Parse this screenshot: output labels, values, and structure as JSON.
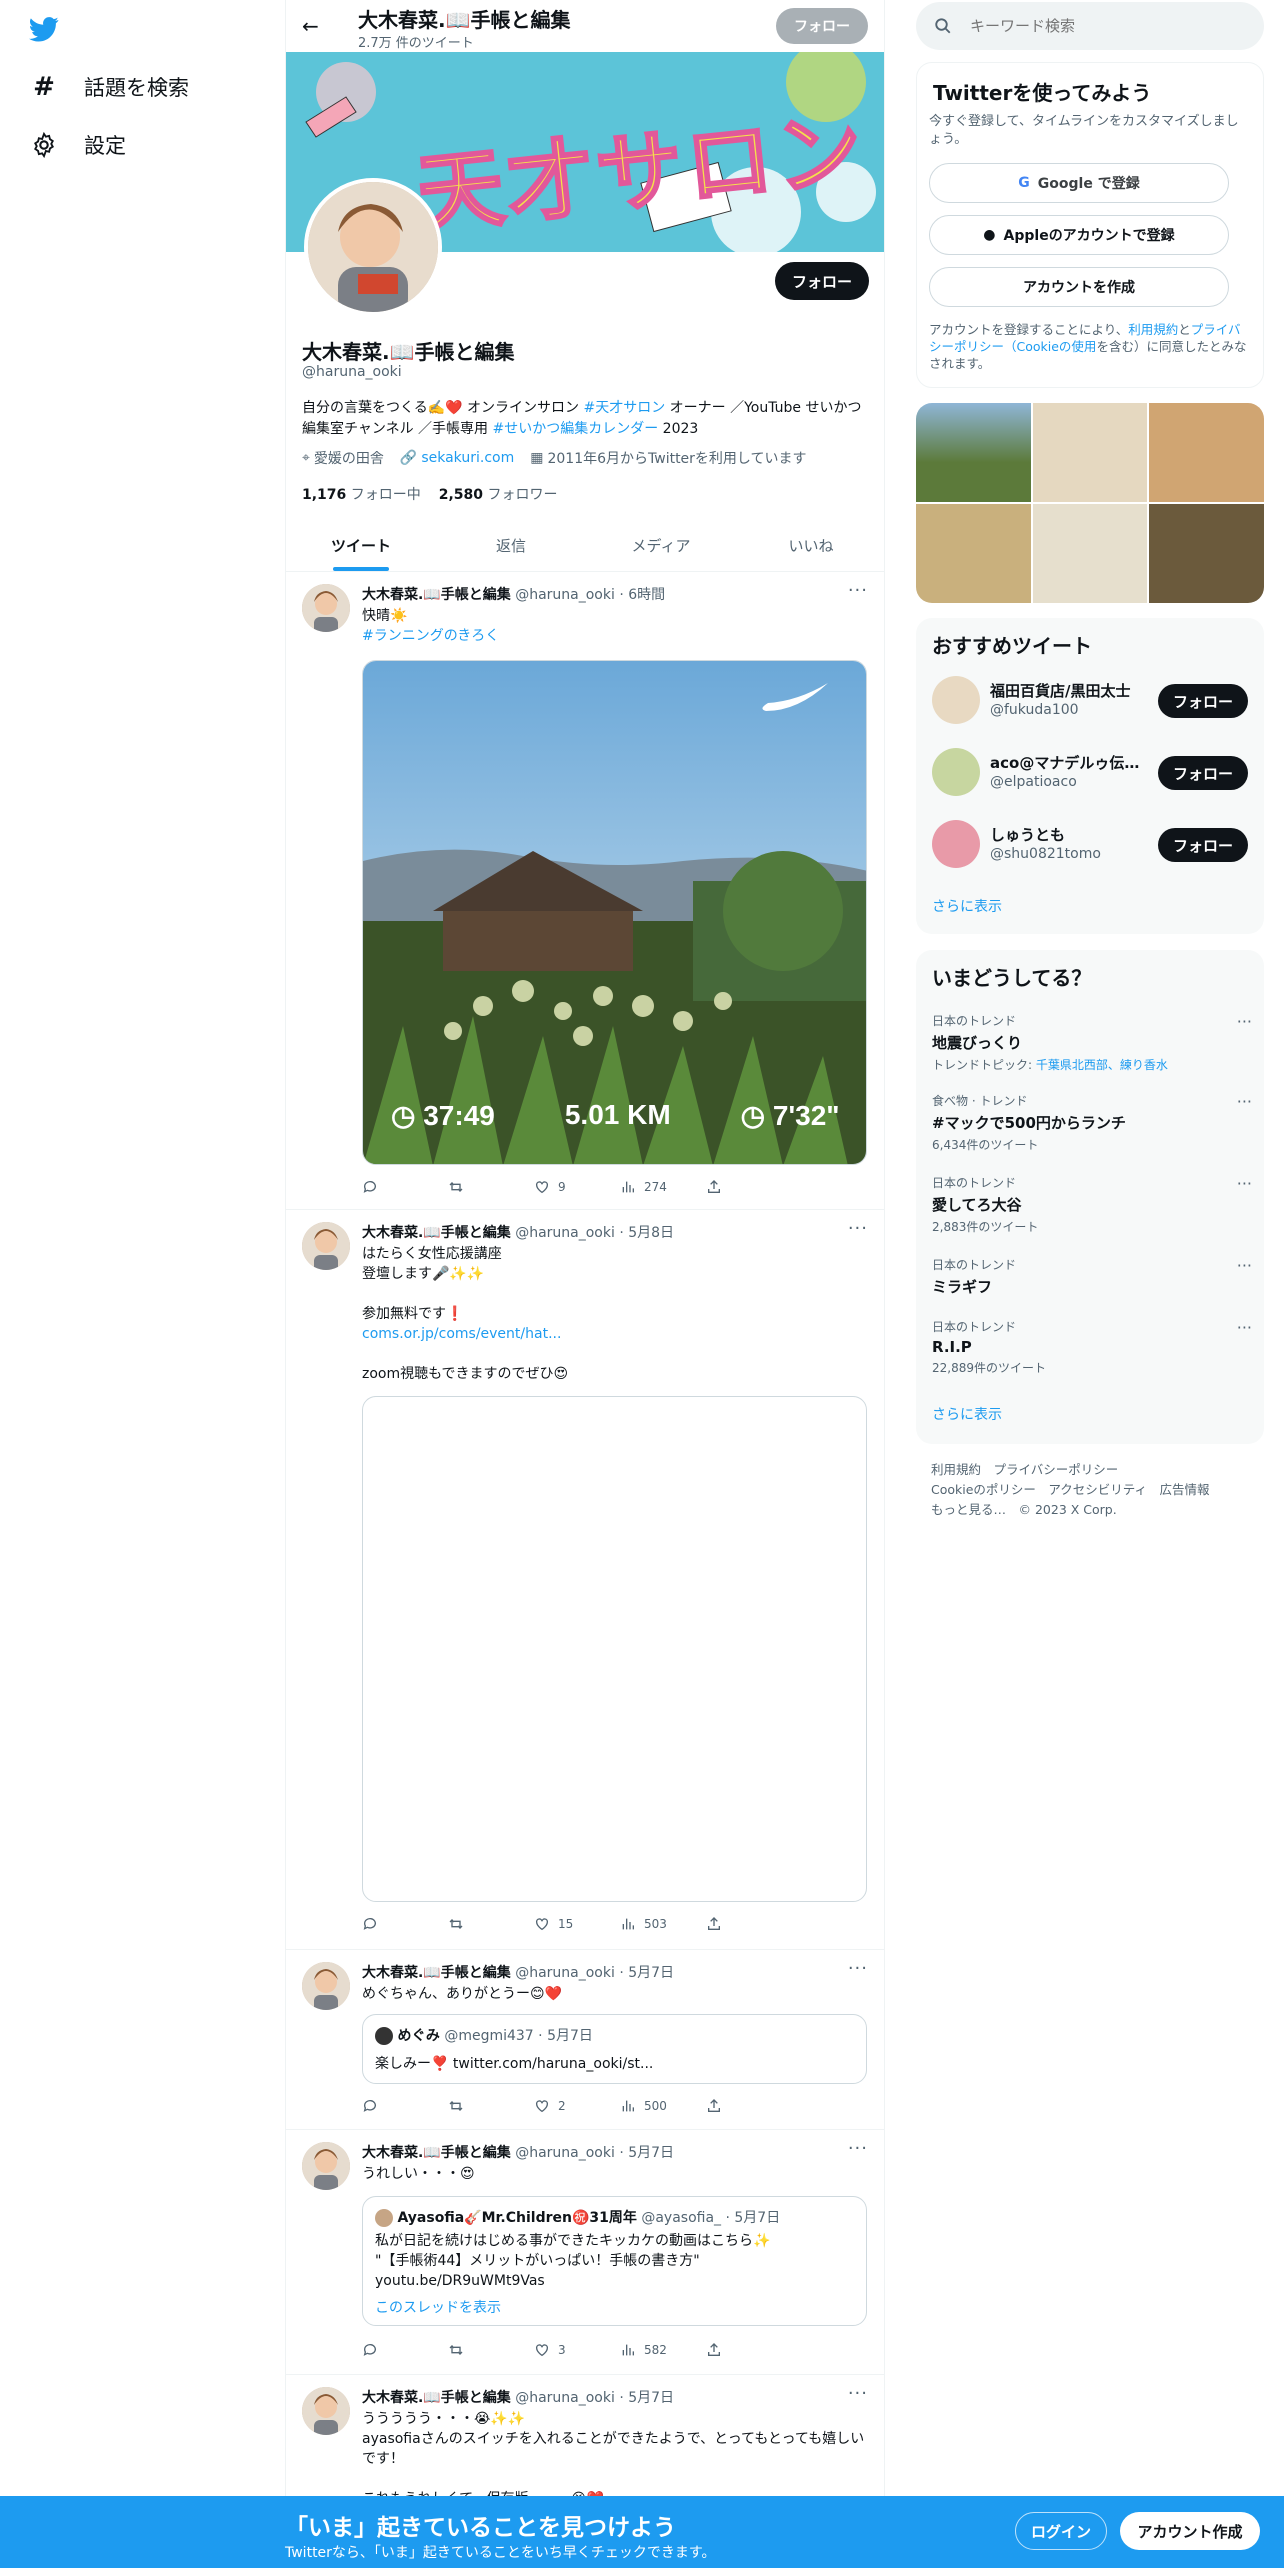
{
  "nav": {
    "explore_label": "話題を検索",
    "settings_label": "設定"
  },
  "profile": {
    "name": "大木春菜.📖手帳と編集",
    "tweet_count": "2.7万 件のツイート",
    "handle": "@haruna_ooki",
    "follow_label": "フォロー",
    "bio_1": "自分の言葉をつくる✍️❤️ オンラインサロン ",
    "bio_tag1": "#天才サロン",
    "bio_2": " オーナー ／YouTube せいかつ編集室チャンネル ／手帳専用 ",
    "bio_tag2": "#せいかつ編集カレンダー",
    "bio_3": " 2023",
    "location": "愛媛の田舎",
    "website": "sekakuri.com",
    "joined": "2011年6月からTwitterを利用しています",
    "following_count": "1,176",
    "following_label": "フォロー中",
    "followers_count": "2,580",
    "followers_label": "フォロワー",
    "banner_text": "天才サロン"
  },
  "tabs": [
    "ツイート",
    "返信",
    "メディア",
    "いいね"
  ],
  "tweets": [
    {
      "name": "大木春菜.📖手帳と編集",
      "handle": "@haruna_ooki",
      "time": " · 6時間",
      "text": "快晴☀️",
      "tag": "#ランニングのきろく",
      "stats": {
        "replies": "",
        "retweets": "",
        "likes": "9",
        "views": "274"
      },
      "run": {
        "time": "37:49",
        "distance": "5.01 KM",
        "pace": "7'32\""
      }
    },
    {
      "name": "大木春菜.📖手帳と編集",
      "handle": "@haruna_ooki",
      "time": " · 5月8日",
      "text": "はたらく女性応援講座\n登壇します🎤✨✨\n\n参加無料です❗️",
      "link": "coms.or.jp/coms/event/hat...",
      "text2": "zoom視聴もできますのでぜひ😍",
      "stats": {
        "replies": "",
        "retweets": "",
        "likes": "15",
        "views": "503"
      }
    },
    {
      "name": "大木春菜.📖手帳と編集",
      "handle": "@haruna_ooki",
      "time": " · 5月7日",
      "text": "めぐちゃん、ありがとうー😊❤️",
      "quote_name": "めぐみ",
      "quote_handle": "@megmi437 · 5月7日",
      "quote_text": "楽しみー❣️ twitter.com/haruna_ooki/st...",
      "stats": {
        "replies": "",
        "retweets": "",
        "likes": "2",
        "views": "500"
      }
    },
    {
      "name": "大木春菜.📖手帳と編集",
      "handle": "@haruna_ooki",
      "time": " · 5月7日",
      "text": "うれしい・・・😍",
      "quote_name": "Ayasofia🎸Mr.Children㊗️31周年",
      "quote_handle": "@ayasofia_ · 5月7日",
      "quote_text": "私が日記を続けはじめる事ができたキッカケの動画はこちら✨\n\"【手帳術44】メリットがいっぱい！手帳の書き方\"\nyoutu.be/DR9uWMt9Vas",
      "quote_link": "このスレッドを表示",
      "stats": {
        "replies": "",
        "retweets": "",
        "likes": "3",
        "views": "582"
      }
    },
    {
      "name": "大木春菜.📖手帳と編集",
      "handle": "@haruna_ooki",
      "time": " · 5月7日",
      "text": "ううううう・・・😭✨✨\nayasofiaさんのスイッチを入れることができたようで、とってもとっても嬉しいです！\n\nこれもうれしくて、保存版・・・😭❤️"
    }
  ],
  "search": {
    "placeholder": "キーワード検索"
  },
  "signup": {
    "title": "Twitterを使ってみよう",
    "subtitle": "今すぐ登録して、タイムラインをカスタマイズしましょう。",
    "google": "Google で登録",
    "apple": "Appleのアカウントで登録",
    "create": "アカウントを作成",
    "terms_1": "アカウントを登録することにより、",
    "terms_link1": "利用規約",
    "terms_2": "と",
    "terms_link2": "プライバシーポリシー（Cookieの使用",
    "terms_3": "を含む）に同意したとみなされます。"
  },
  "recommend": {
    "title": "おすすめツイート",
    "users": [
      {
        "name": "福田百貨店/黒田太士",
        "handle": "@fukuda100",
        "button": "フォロー"
      },
      {
        "name": "aco@マナデルゥ伝...",
        "handle": "@elpatioaco",
        "button": "フォロー"
      },
      {
        "name": "しゅうとも",
        "handle": "@shu0821tomo",
        "button": "フォロー"
      }
    ],
    "more": "さらに表示"
  },
  "trends": {
    "title": "いまどうしてる？",
    "items": [
      {
        "meta": "日本のトレンド",
        "name": "地震びっくり",
        "sub_label": "トレンドトピック: ",
        "sub_link": "千葉県北西部、練り香水"
      },
      {
        "meta": "食べ物 · トレンド",
        "name": "#マックで500円からランチ",
        "sub": "6,434件のツイート"
      },
      {
        "meta": "日本のトレンド",
        "name": "愛してろ大谷",
        "sub": "2,883件のツイート"
      },
      {
        "meta": "日本のトレンド",
        "name": "ミラギフ",
        "sub": ""
      },
      {
        "meta": "日本のトレンド",
        "name": "R.I.P",
        "sub": "22,889件のツイート"
      }
    ],
    "more": "さらに表示"
  },
  "footer": {
    "line1": "利用規約　プライバシーポリシー",
    "line2": "Cookieのポリシー　アクセシビリティ　広告情報",
    "line3": "もっと見る…　© 2023 X Corp."
  },
  "bottom": {
    "title": "「いま」起きていることを見つけよう",
    "subtitle": "Twitterなら、「いま」起きていることをいち早くチェックできます。",
    "login": "ログイン",
    "signup": "アカウント作成"
  }
}
